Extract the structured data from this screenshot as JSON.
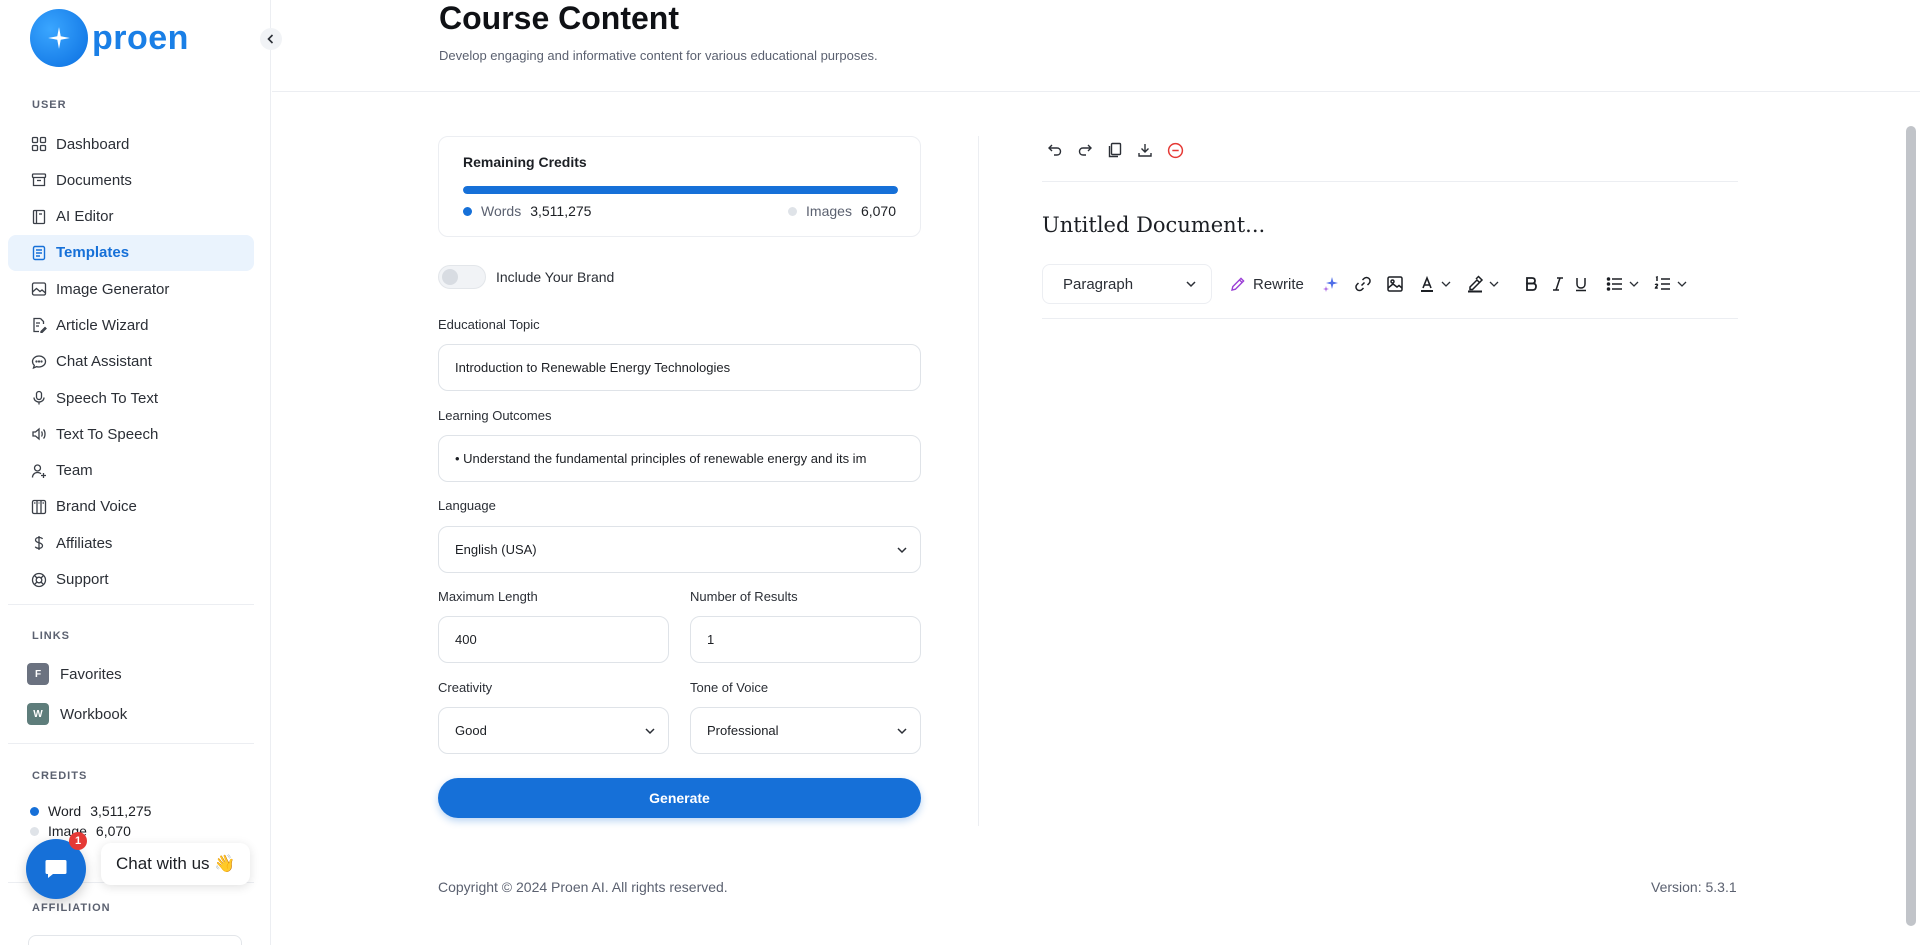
{
  "app": {
    "brand": "proen"
  },
  "sidebar": {
    "user_section_label": "USER",
    "items": [
      {
        "label": "Dashboard",
        "icon": "grid-icon"
      },
      {
        "label": "Documents",
        "icon": "archive-icon"
      },
      {
        "label": "AI Editor",
        "icon": "book-icon"
      },
      {
        "label": "Templates",
        "icon": "document-icon",
        "active": true
      },
      {
        "label": "Image Generator",
        "icon": "image-icon"
      },
      {
        "label": "Article Wizard",
        "icon": "file-edit-icon"
      },
      {
        "label": "Chat Assistant",
        "icon": "chat-icon"
      },
      {
        "label": "Speech To Text",
        "icon": "microphone-icon"
      },
      {
        "label": "Text To Speech",
        "icon": "speaker-icon"
      },
      {
        "label": "Team",
        "icon": "user-plus-icon"
      },
      {
        "label": "Brand Voice",
        "icon": "columns-icon"
      },
      {
        "label": "Affiliates",
        "icon": "dollar-icon"
      },
      {
        "label": "Support",
        "icon": "lifebuoy-icon"
      }
    ],
    "links_section_label": "LINKS",
    "links": [
      {
        "badge": "F",
        "label": "Favorites",
        "color": "#6b7280"
      },
      {
        "badge": "W",
        "label": "Workbook",
        "color": "#5e7d7b"
      }
    ],
    "credits_section_label": "CREDITS",
    "credits": {
      "word_label": "Word",
      "word_value": "3,511,275",
      "image_label": "Image",
      "image_value": "6,070"
    },
    "affiliation_section_label": "AFFILIATION"
  },
  "chat_widget": {
    "label": "Chat with us 👋",
    "badge_count": "1"
  },
  "header": {
    "title": "Course Content",
    "subtitle": "Develop engaging and informative content for various educational purposes."
  },
  "form": {
    "remaining_credits": {
      "title": "Remaining Credits",
      "words_label": "Words",
      "words_value": "3,511,275",
      "images_label": "Images",
      "images_value": "6,070",
      "words_fill": 1.0
    },
    "brand_toggle_label": "Include Your Brand",
    "educational_topic": {
      "label": "Educational Topic",
      "value": "Introduction to Renewable Energy Technologies"
    },
    "learning_outcomes": {
      "label": "Learning Outcomes",
      "value": "•  Understand the fundamental principles of renewable energy and its im"
    },
    "language": {
      "label": "Language",
      "value": "English (USA)"
    },
    "max_length": {
      "label": "Maximum Length",
      "value": "400"
    },
    "num_results": {
      "label": "Number of Results",
      "value": "1"
    },
    "creativity": {
      "label": "Creativity",
      "value": "Good"
    },
    "tone": {
      "label": "Tone of Voice",
      "value": "Professional"
    },
    "generate_label": "Generate"
  },
  "editor": {
    "document_title": "Untitled Document...",
    "block_type": "Paragraph",
    "rewrite_label": "Rewrite",
    "toolbar_icons": [
      "undo-icon",
      "redo-icon",
      "copy-icon",
      "download-icon",
      "delete-icon"
    ]
  },
  "footer": {
    "copyright": "Copyright © 2024 Proen AI. All rights reserved.",
    "version": "Version: 5.3.1"
  },
  "colors": {
    "accent": "#1670d8",
    "brand": "#1a7fe6",
    "danger": "#e53935"
  }
}
